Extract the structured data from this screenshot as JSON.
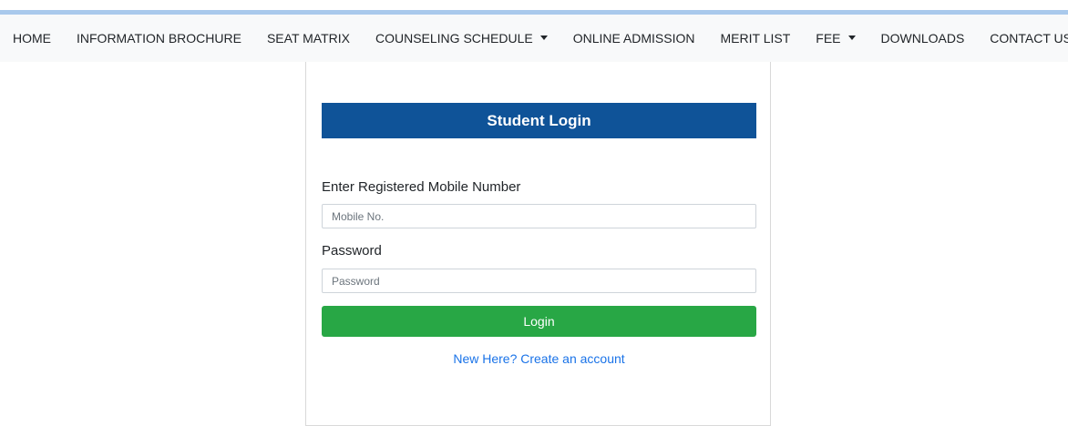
{
  "navbar": {
    "items": [
      {
        "label": "HOME"
      },
      {
        "label": "INFORMATION BROCHURE"
      },
      {
        "label": "SEAT MATRIX"
      },
      {
        "label": "COUNSELING SCHEDULE"
      },
      {
        "label": "ONLINE ADMISSION"
      },
      {
        "label": "MERIT LIST"
      },
      {
        "label": "FEE"
      },
      {
        "label": "DOWNLOADS"
      },
      {
        "label": "CONTACT US"
      }
    ]
  },
  "login": {
    "title": "Student Login",
    "mobile_label": "Enter Registered Mobile Number",
    "mobile_placeholder": "Mobile No.",
    "mobile_value": "",
    "password_label": "Password",
    "password_placeholder": "Password",
    "password_value": "",
    "button_label": "Login",
    "create_account_link": "New Here? Create an account"
  },
  "colors": {
    "header_bg": "#0f5398",
    "button_bg": "#28a745",
    "link": "#1a73e8",
    "navbar_bg": "#f8f9fa",
    "top_strip": "#a9c9ec"
  }
}
